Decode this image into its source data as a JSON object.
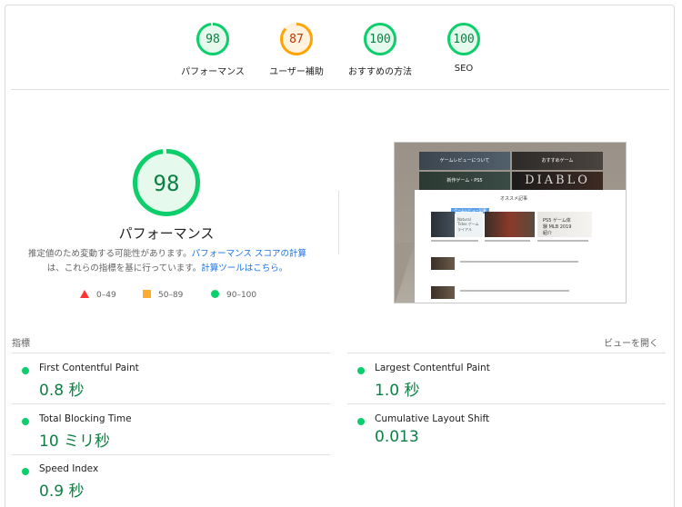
{
  "gauges": [
    {
      "label": "パフォーマンス",
      "score": "98",
      "fraction": 0.98,
      "color": "#0cce6b",
      "fill": "#e6f9ed",
      "text_color": "#0b8043"
    },
    {
      "label": "ユーザー補助",
      "score": "87",
      "fraction": 0.87,
      "color": "#ffa400",
      "fill": "#fff3e0",
      "text_color": "#c33300"
    },
    {
      "label": "おすすめの方法",
      "score": "100",
      "fraction": 1.0,
      "color": "#0cce6b",
      "fill": "#e6f9ed",
      "text_color": "#0b8043"
    },
    {
      "label": "SEO",
      "score": "100",
      "fraction": 1.0,
      "color": "#0cce6b",
      "fill": "#e6f9ed",
      "text_color": "#0b8043"
    }
  ],
  "main": {
    "score": "98",
    "fraction": 0.98,
    "title": "パフォーマンス",
    "desc_prefix": "推定値のため変動する可能性があります。",
    "desc_link1": "パフォーマンス スコアの計算",
    "desc_middle": "は、これらの指標を基に行っています。",
    "desc_link2": "計算ツールはこちら。"
  },
  "legend": {
    "fail": "0–49",
    "average": "50–89",
    "pass": "90–100"
  },
  "colors": {
    "pass": "#0cce6b",
    "average": "#ffa400",
    "fail": "#ff3333",
    "link": "#1a73e8"
  },
  "screenshot": {
    "nav1": "ゲームレビューについて",
    "nav2": "おすすめゲーム",
    "nav3": "新作ゲーム・PS5",
    "nav4": "DIABLO",
    "section": "オススメ記事",
    "badge": "ゲームレビュー記事",
    "thumb_text": "PS5 ゲーム体験 MLB 2019 紹介",
    "thumb_game": "Natural Tides ゲームライアル"
  },
  "metrics": {
    "header": "指標",
    "expand": "ビューを開く",
    "items": [
      {
        "name": "First Contentful Paint",
        "value": "0.8 秒"
      },
      {
        "name": "Largest Contentful Paint",
        "value": "1.0 秒"
      },
      {
        "name": "Total Blocking Time",
        "value": "10 ミリ秒"
      },
      {
        "name": "Cumulative Layout Shift",
        "value": "0.013"
      },
      {
        "name": "Speed Index",
        "value": "0.9 秒"
      }
    ]
  }
}
